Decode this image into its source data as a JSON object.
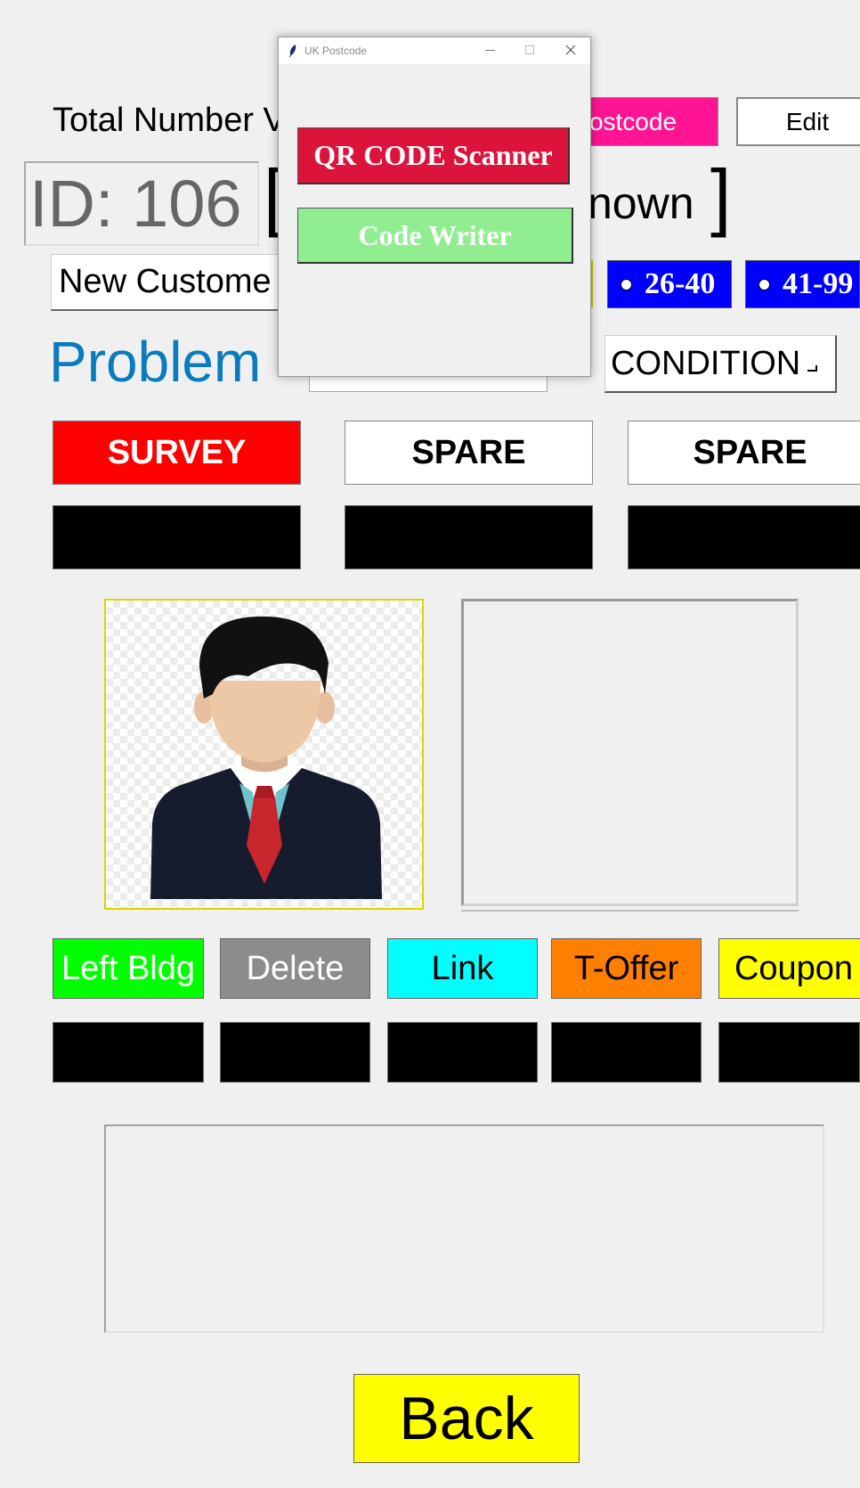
{
  "header": {
    "total_label": "Total Number V",
    "postcode_button": "ostcode",
    "edit_button": "Edit",
    "id_text": "ID: 106",
    "bracket_open": "[",
    "status_text": "nown",
    "bracket_close": "]"
  },
  "customer": {
    "type_value": "New Custome"
  },
  "age_options": [
    "26-40",
    "41-99"
  ],
  "problem": {
    "label": "Problem",
    "condition_label": "CONDITION"
  },
  "actions_row1": [
    "SURVEY",
    "SPARE",
    "SPARE"
  ],
  "actions_row2": [
    "Left Bldg",
    "Delete",
    "Link",
    "T-Offer",
    "Coupon"
  ],
  "back_button": "Back",
  "popup": {
    "title": "UK Postcode",
    "qr_button": "QR CODE Scanner",
    "writer_button": "Code Writer"
  },
  "colors": {
    "survey": "#ff0000",
    "left_bldg": "#00ff00",
    "delete": "#8c8c8c",
    "link": "#00ffff",
    "t_offer": "#ff8000",
    "coupon": "#ffff00",
    "back": "#ffff00",
    "postcode": "#ff1493",
    "radio": "#0000ff",
    "problem_text": "#0a7bbd",
    "qr_button": "#dc143c",
    "writer_button": "#90ee90"
  },
  "icons": [
    "minimize-icon",
    "maximize-icon",
    "close-icon",
    "feather-icon",
    "avatar-image"
  ]
}
